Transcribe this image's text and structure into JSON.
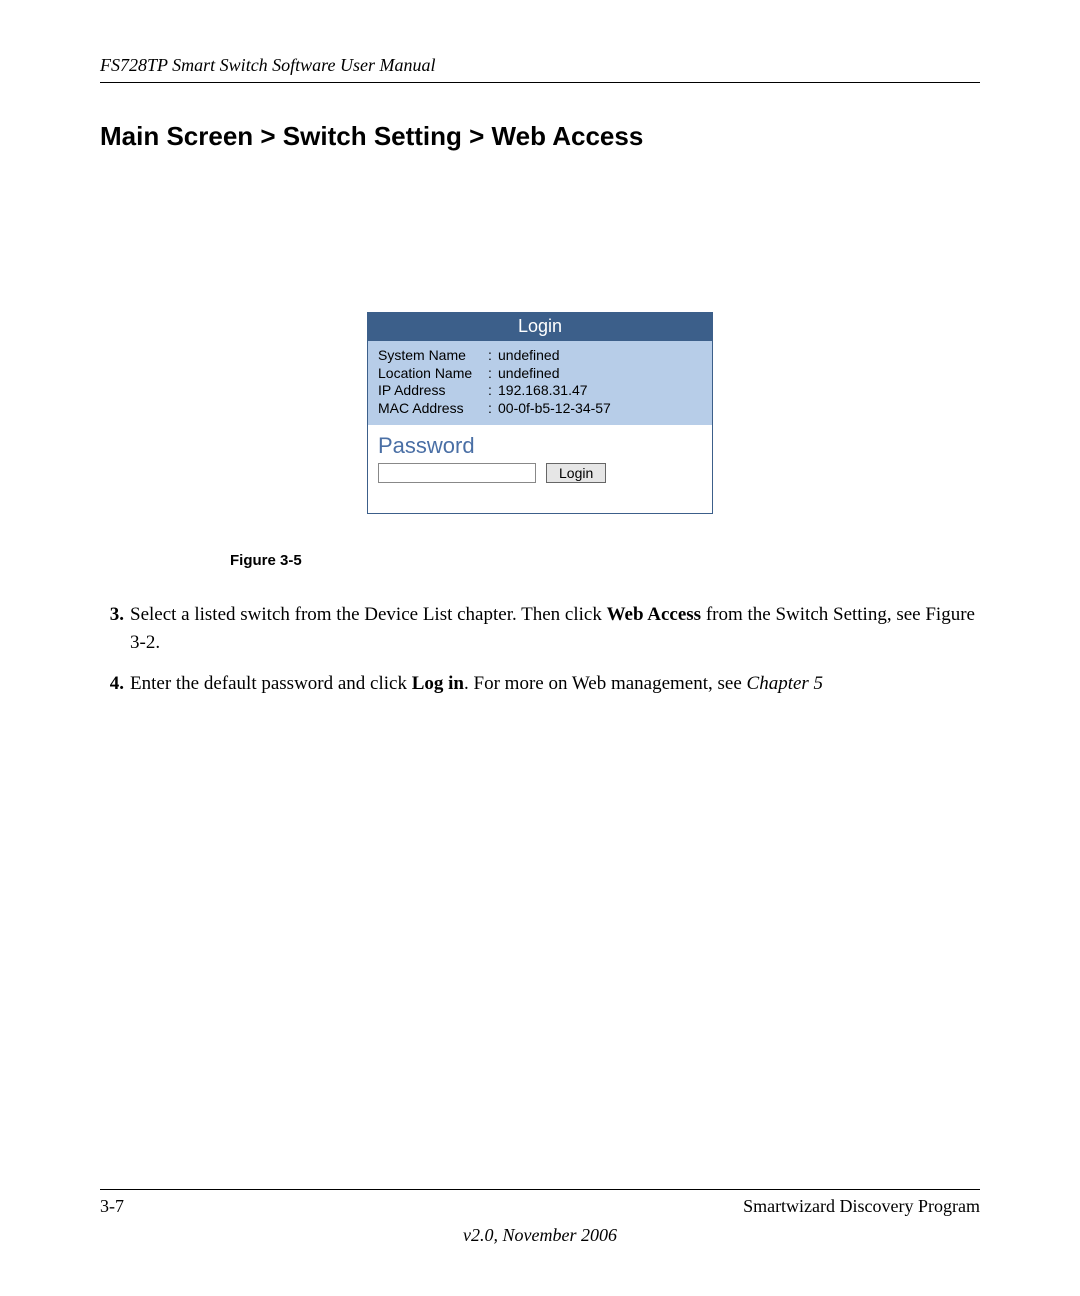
{
  "header": {
    "title": "FS728TP Smart Switch Software User Manual"
  },
  "section": {
    "title": "Main Screen > Switch Setting > Web Access"
  },
  "login_box": {
    "title": "Login",
    "rows": [
      {
        "label": "System Name",
        "value": "undefined"
      },
      {
        "label": "Location Name",
        "value": "undefined"
      },
      {
        "label": "IP Address",
        "value": "192.168.31.47"
      },
      {
        "label": "MAC Address",
        "value": "00-0f-b5-12-34-57"
      }
    ],
    "password_label": "Password",
    "login_button": "Login"
  },
  "figure_caption": "Figure 3-5",
  "steps": [
    {
      "num": "3.",
      "pre": "Select a listed switch from the Device List chapter. Then click ",
      "bold": "Web Access",
      "post": " from the Switch Setting, see Figure 3-2."
    },
    {
      "num": "4.",
      "pre": "Enter the default password and click ",
      "bold": "Log in",
      "post": ". For more on Web management, see ",
      "italic": "Chapter 5"
    }
  ],
  "footer": {
    "page": "3-7",
    "program": "Smartwizard Discovery Program",
    "version": "v2.0, November 2006"
  }
}
